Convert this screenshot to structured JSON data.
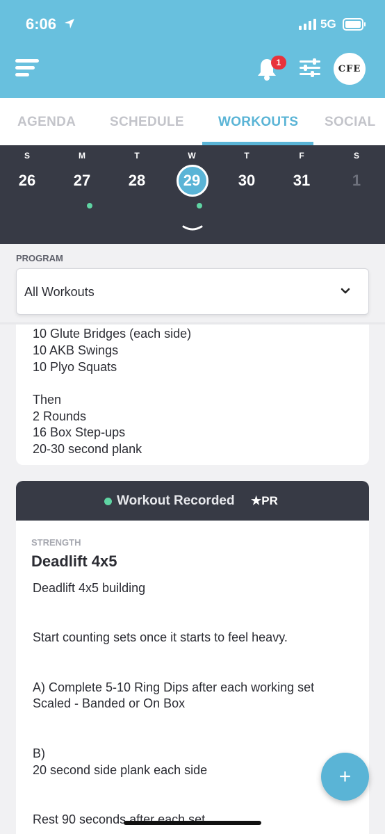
{
  "status_bar": {
    "time": "6:06",
    "network": "5G"
  },
  "header": {
    "notification_count": "1",
    "avatar_text": "CFE"
  },
  "tabs": [
    {
      "label": "AGENDA"
    },
    {
      "label": "SCHEDULE"
    },
    {
      "label": "WORKOUTS",
      "active": true
    },
    {
      "label": "SOCIAL"
    }
  ],
  "calendar": {
    "days": [
      {
        "dow": "S",
        "num": "26"
      },
      {
        "dow": "M",
        "num": "27",
        "has_workout": true
      },
      {
        "dow": "T",
        "num": "28"
      },
      {
        "dow": "W",
        "num": "29",
        "selected": true,
        "has_workout": true
      },
      {
        "dow": "T",
        "num": "30"
      },
      {
        "dow": "F",
        "num": "31"
      },
      {
        "dow": "S",
        "num": "1",
        "muted": true
      }
    ]
  },
  "program": {
    "label": "PROGRAM",
    "value": "All Workouts"
  },
  "card1": {
    "lines": [
      "10 Glute Bridges (each side)",
      "10 AKB Swings",
      "10 Plyo Squats",
      "",
      "Then",
      "2 Rounds",
      "16 Box Step-ups",
      "20-30 second plank"
    ]
  },
  "card2": {
    "status": "Workout Recorded",
    "pr": "★PR",
    "section": "STRENGTH",
    "title": "Deadlift 4x5",
    "lines": [
      "Deadlift 4x5 building",
      "Start counting sets once it starts to feel heavy.",
      "A) Complete 5-10 Ring Dips after each working set",
      "Scaled - Banded or On Box",
      "B)",
      "20 second side plank each side",
      "Rest 90 seconds after each set"
    ]
  },
  "fab": {
    "label": "+"
  },
  "colors": {
    "header": "#68c0de",
    "accent": "#5ab4d6",
    "dark": "#373a45",
    "green": "#5fd4a3",
    "badge": "#e8323c"
  }
}
